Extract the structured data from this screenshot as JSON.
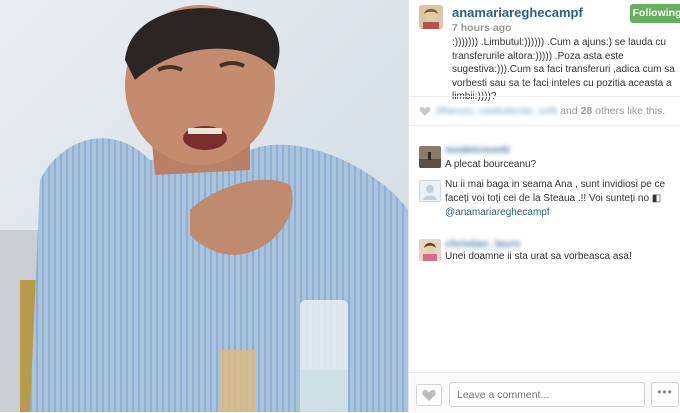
{
  "post": {
    "username": "anamariareghecampf",
    "follow_label": "Following",
    "time": "7 hours ago",
    "caption": ":))))))) .Limbutul:)))))) .Cum a ajuns:) se lauda cu transferurile altora:))))) .Poza asta este sugestiva:))).Cum sa faci transferuri ,adica cum sa vorbesti sau sa te faci inteles cu pozitia aceasta a limbii:))))?"
  },
  "likes": {
    "names": "tiffanoni, cawkalecite, xxltt",
    "suffix_and": " and ",
    "count": "28",
    "suffix_others": " others like this."
  },
  "comments": [
    {
      "author": "modelcovetti",
      "text": "A plecat bourceanu?"
    },
    {
      "author": "",
      "text": "Nu ii mai baga in seama Ana , sunt invidiosi pe ce faceți voi toți cei de la Steaua .!! Voi sunteți no",
      "mention": "@anamariareghecampf"
    },
    {
      "author": "christian_laurn",
      "text": "Unei doamne ii sta urat sa vorbeasca asa!"
    }
  ],
  "footer": {
    "comment_placeholder": "Leave a comment...",
    "more_label": "•••"
  },
  "icons": {
    "like": "heart-icon",
    "more": "more-options-icon"
  },
  "colors": {
    "following": "#63b15b",
    "username": "#2d5f86"
  }
}
